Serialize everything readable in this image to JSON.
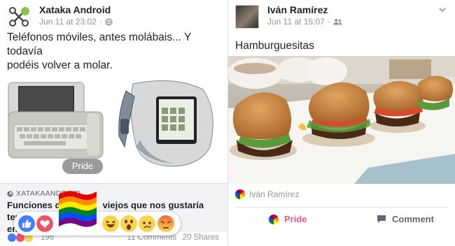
{
  "left_post": {
    "author": "Xataka Android",
    "timestamp": "Jun 11 at 23:02",
    "privacy_icon": "globe-icon",
    "text_line1": "Teléfonos móviles, antes molábais... Y todavía",
    "text_line2": "podéis volver a molar.",
    "pride_badge": "Pride",
    "link_source": "XATAKAANDROID",
    "link_title_visible_1": "Funciones d",
    "link_title_visible_2": "viejos que nos gustaría tener",
    "link_title_line2": "en",
    "reactions_count": "196",
    "comments": "11 Comments",
    "shares": "20 Shares"
  },
  "right_post": {
    "author": "Iván Ramírez",
    "timestamp": "Jun 11 at 15:07",
    "privacy_icon": "friends-icon",
    "text": "Hamburguesitas",
    "seen_name": "Iván Ramírez",
    "pride_action": "Pride",
    "comment_action": "Comment"
  },
  "colors": {
    "link_blue": "#365899",
    "meta_gray": "#90949c",
    "pride_pink": "#e05a8a",
    "like_blue": "#4080ff",
    "love_red": "#f25268",
    "haha_yellow": "#fcd34d",
    "angry_orange": "#f06a3c"
  }
}
